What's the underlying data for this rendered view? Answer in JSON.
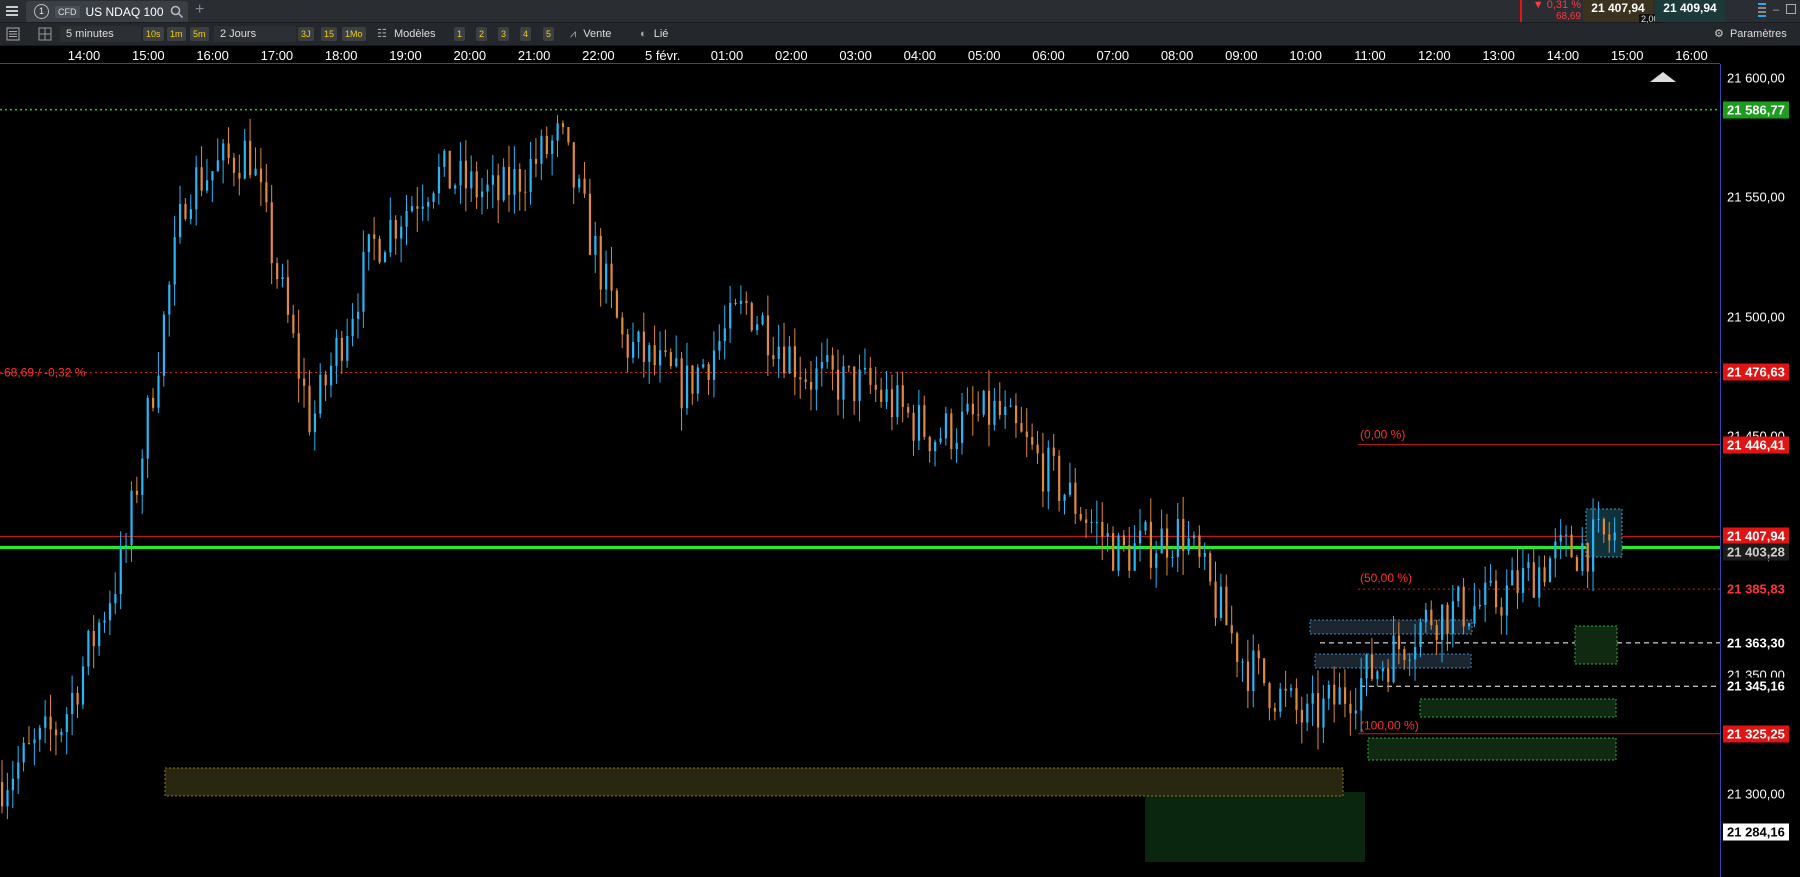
{
  "tab": {
    "number": "1",
    "badge": "CFD",
    "title": "US NDAQ 100"
  },
  "toolbar": {
    "timeframe": "5 minutes",
    "quick_intervals": [
      "10s",
      "1m",
      "5m"
    ],
    "range": "2 Jours",
    "range_buttons": [
      "3J",
      "15",
      "1Mo"
    ],
    "models_label": "Modèles",
    "layouts": [
      "1",
      "2",
      "3",
      "4",
      "5"
    ],
    "sell_label": "Vente",
    "linked_label": "Lié",
    "settings_label": "Paramètres"
  },
  "quote": {
    "change_pct": "0,31 %",
    "change_pts": "68,69",
    "bid": "21 407,94",
    "spread": "2,00",
    "ask": "21 409,94"
  },
  "time_axis": [
    "14:00",
    "15:00",
    "16:00",
    "17:00",
    "18:00",
    "19:00",
    "20:00",
    "21:00",
    "22:00",
    "5 févr.",
    "01:00",
    "02:00",
    "03:00",
    "04:00",
    "05:00",
    "06:00",
    "07:00",
    "08:00",
    "09:00",
    "10:00",
    "11:00",
    "12:00",
    "13:00",
    "14:00",
    "15:00",
    "16:00"
  ],
  "price_axis": [
    "21 600,00",
    "21 550,00",
    "21 500,00",
    "21 450,00",
    "21 400,00",
    "21 350,00",
    "21 300,00"
  ],
  "price_tags": {
    "high_line": "21 586,77",
    "prev_close": "21 476,63",
    "fib_0": "21 446,41",
    "current": "21 407,94",
    "green_line": "21 403,28",
    "red_dotted": "21 385,83",
    "white_dashed_1": "21 363,30",
    "white_dashed_2": "21 345,16",
    "fib_100": "21 325,25",
    "bottom": "21 284,16"
  },
  "annotations": {
    "prev_close_label": "-68,69 / -0,32 %",
    "fib_0_label": "(0,00 %)",
    "fib_50_label": "(50,00 %)",
    "fib_100_label": "(100,00 %)"
  },
  "colors": {
    "up_candle": "#29b6f6",
    "down_candle": "#e08a3c",
    "red": "#ff1a1a",
    "green_line": "#22ee22",
    "green_dotted": "#22cc22"
  },
  "chart_data": {
    "type": "candlestick",
    "title": "US NDAQ 100",
    "x_range": [
      "14:00",
      "16:00"
    ],
    "ylim": [
      21284.16,
      21610
    ],
    "anchors": [
      {
        "t": "14:00",
        "close": 21305
      },
      {
        "t": "15:00",
        "close": 21330
      },
      {
        "t": "15:40",
        "close": 21400
      },
      {
        "t": "16:30",
        "close": 21555
      },
      {
        "t": "17:20",
        "close": 21570
      },
      {
        "t": "18:10",
        "close": 21455
      },
      {
        "t": "19:00",
        "close": 21530
      },
      {
        "t": "20:00",
        "close": 21560
      },
      {
        "t": "21:00",
        "close": 21550
      },
      {
        "t": "21:40",
        "close": 21575
      },
      {
        "t": "22:30",
        "close": 21490
      },
      {
        "t": "5 févr. 00:30",
        "close": 21470
      },
      {
        "t": "02:00",
        "close": 21505
      },
      {
        "t": "03:00",
        "close": 21475
      },
      {
        "t": "04:00",
        "close": 21470
      },
      {
        "t": "05:00",
        "close": 21450
      },
      {
        "t": "06:00",
        "close": 21460
      },
      {
        "t": "07:00",
        "close": 21430
      },
      {
        "t": "08:00",
        "close": 21400
      },
      {
        "t": "09:00",
        "close": 21410
      },
      {
        "t": "10:00",
        "close": 21355
      },
      {
        "t": "10:30",
        "close": 21330
      },
      {
        "t": "11:00",
        "close": 21350
      },
      {
        "t": "12:00",
        "close": 21375
      },
      {
        "t": "13:00",
        "close": 21380
      },
      {
        "t": "14:00",
        "close": 21400
      },
      {
        "t": "14:40",
        "close": 21407.94
      }
    ]
  }
}
